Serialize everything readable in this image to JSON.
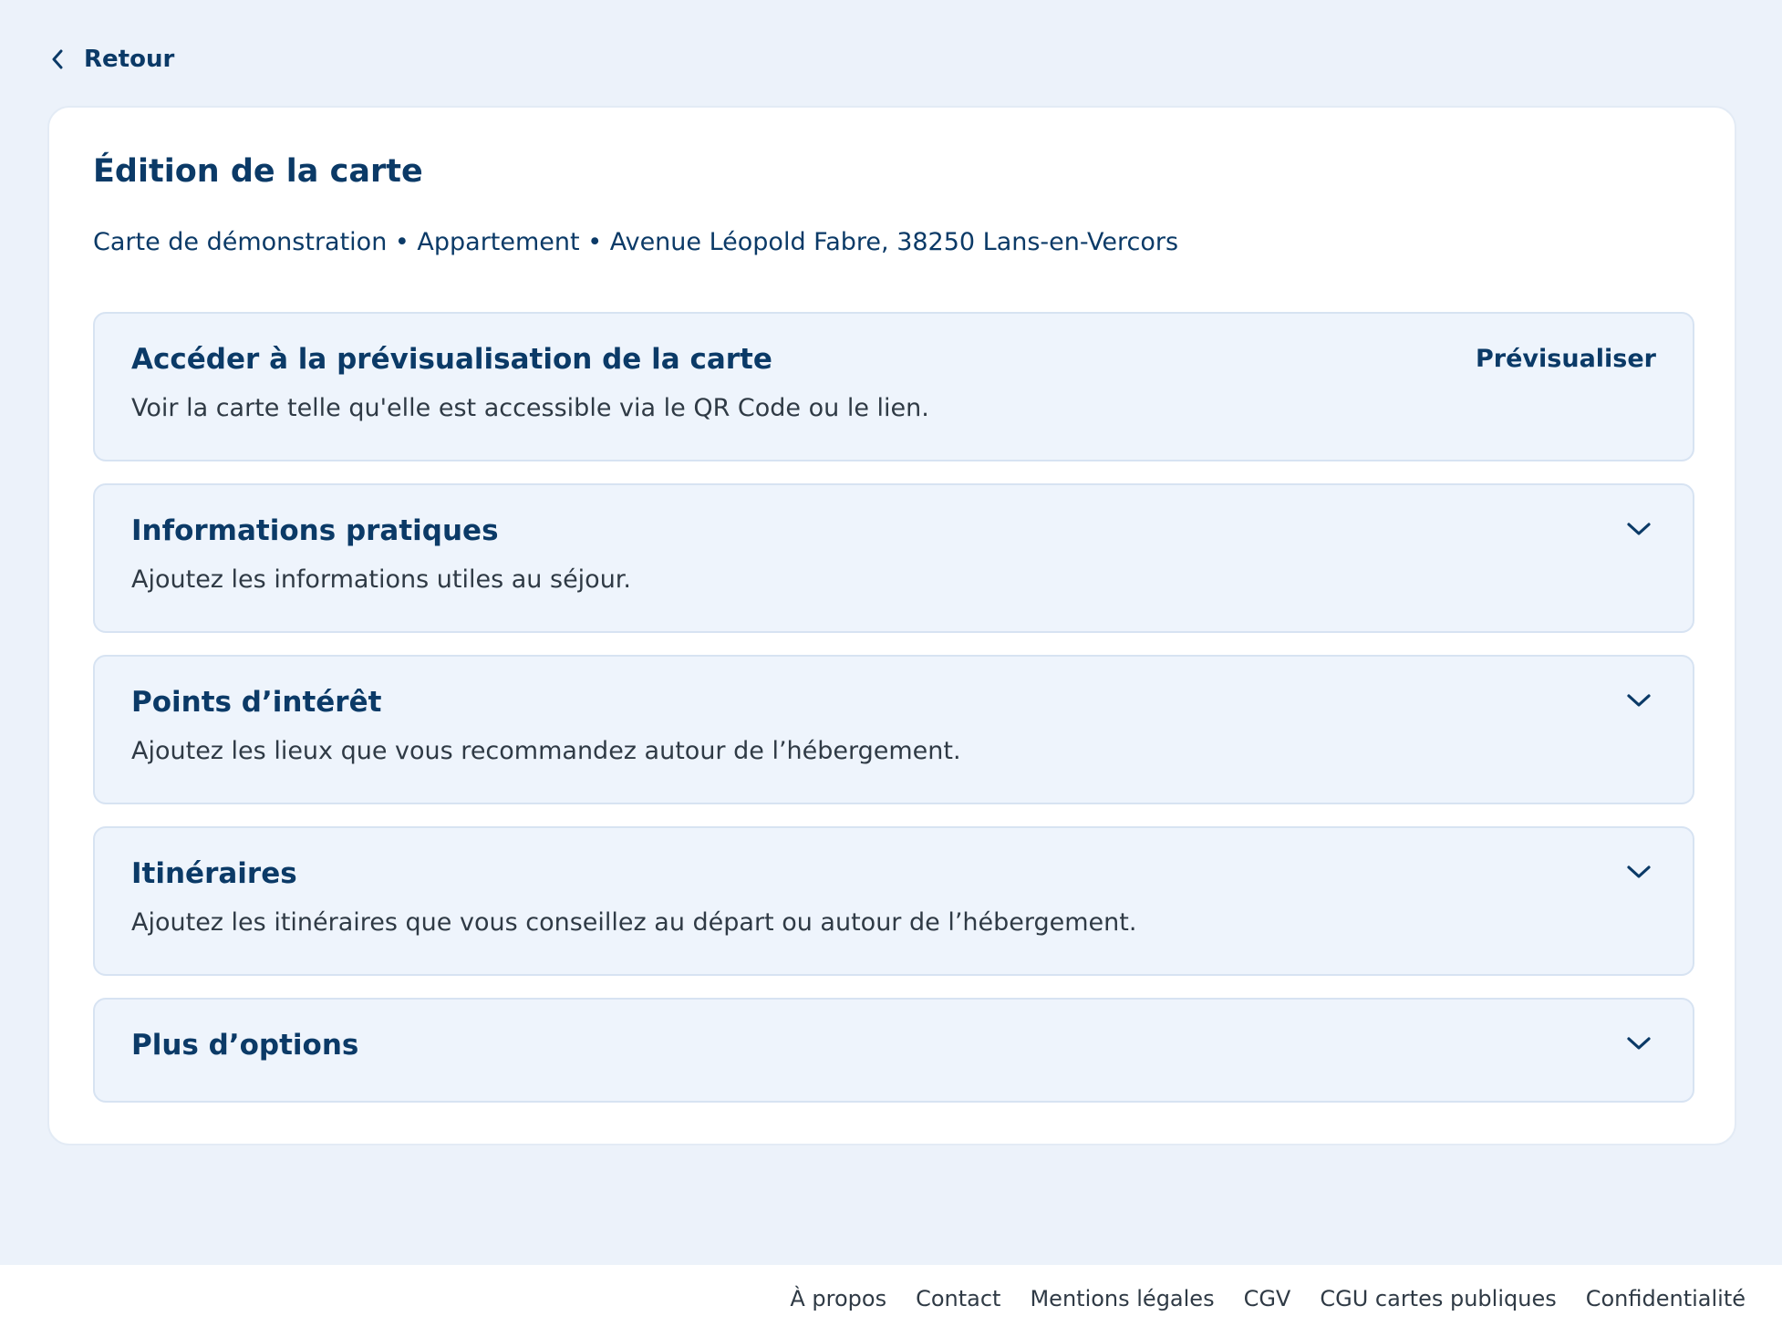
{
  "nav": {
    "back_label": "Retour"
  },
  "card": {
    "title": "Édition de la carte",
    "subtitle": "Carte de démonstration • Appartement • Avenue Léopold Fabre, 38250 Lans-en-Vercors"
  },
  "sections": [
    {
      "title": "Accéder à la prévisualisation de la carte",
      "description": "Voir la carte telle qu'elle est accessible via le QR Code ou le lien.",
      "action_label": "Prévisualiser"
    },
    {
      "title": "Informations pratiques",
      "description": "Ajoutez les informations utiles au séjour.",
      "icon": "chevron-down-icon"
    },
    {
      "title": "Points d’intérêt",
      "description": "Ajoutez les lieux que vous recommandez autour de l’hébergement.",
      "icon": "chevron-down-icon"
    },
    {
      "title": "Itinéraires",
      "description": "Ajoutez les itinéraires que vous conseillez au départ ou autour de l’hébergement.",
      "icon": "chevron-down-icon"
    },
    {
      "title": "Plus d’options",
      "icon": "chevron-down-icon"
    }
  ],
  "footer": {
    "links": [
      "À propos",
      "Contact",
      "Mentions légales",
      "CGV",
      "CGU cartes publiques",
      "Confidentialité"
    ]
  },
  "colors": {
    "background": "#ecf2fa",
    "primary_text": "#0b3a67",
    "section_background": "#eef4fc",
    "section_border": "#d7e3f2"
  }
}
